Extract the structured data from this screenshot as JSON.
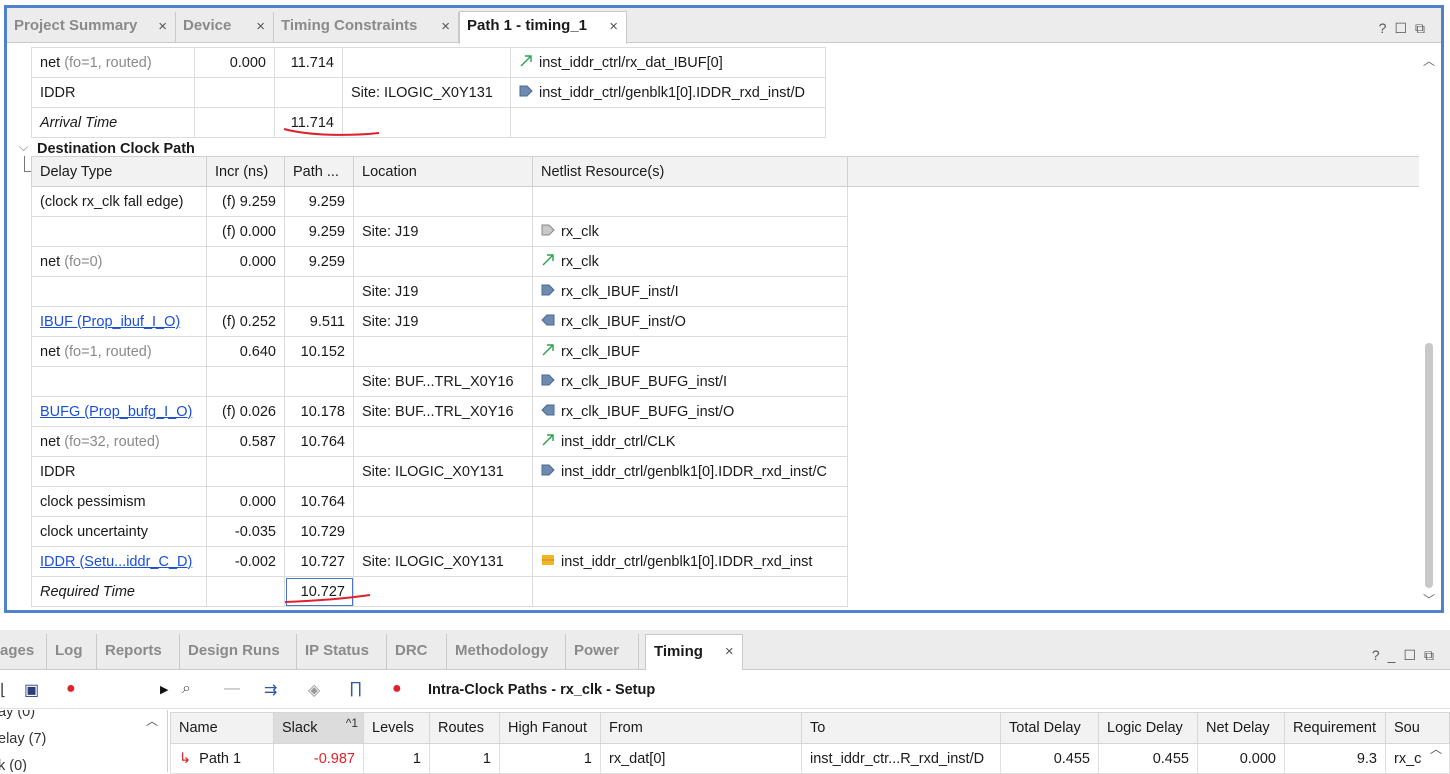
{
  "upper_tabs": [
    {
      "label": "Project Summary"
    },
    {
      "label": "Device"
    },
    {
      "label": "Timing Constraints"
    },
    {
      "label": "Path 1 - timing_1"
    }
  ],
  "top_rows": [
    {
      "type": "net",
      "detail": "(fo=1, routed)",
      "incr": "0.000",
      "path": "11.714",
      "location": "",
      "icon": "net-arrow-icon",
      "netlist": "inst_iddr_ctrl/rx_dat_IBUF[0]"
    },
    {
      "type": "IDDR",
      "detail": "",
      "incr": "",
      "path": "",
      "location": "Site: ILOGIC_X0Y131",
      "icon": "pin-in-icon",
      "netlist": "inst_iddr_ctrl/genblk1[0].IDDR_rxd_inst/D"
    }
  ],
  "arrival": {
    "label": "Arrival Time",
    "value": "11.714"
  },
  "destination": {
    "title": "Destination Clock Path",
    "columns": [
      "Delay Type",
      "Incr (ns)",
      "Path ...",
      "Location",
      "Netlist Resource(s)"
    ],
    "rows": [
      {
        "type": "(clock rx_clk fall edge)",
        "detail": "",
        "incr": "(f) 9.259",
        "path": "9.259",
        "location": "",
        "icon": "",
        "netlist": ""
      },
      {
        "type": "",
        "detail": "",
        "incr": "(f) 0.000",
        "path": "9.259",
        "location": "Site: J19",
        "icon": "port-icon",
        "netlist": "rx_clk"
      },
      {
        "type": "net",
        "detail": "(fo=0)",
        "incr": "0.000",
        "path": "9.259",
        "location": "",
        "icon": "net-arrow-icon",
        "netlist": "rx_clk"
      },
      {
        "type": "",
        "detail": "",
        "incr": "",
        "path": "",
        "location": "Site: J19",
        "icon": "pin-in-icon",
        "netlist": "rx_clk_IBUF_inst/I"
      },
      {
        "type": "IBUF (Prop_ibuf_I_O)",
        "link": true,
        "detail": "",
        "incr": "(f) 0.252",
        "path": "9.511",
        "location": "Site: J19",
        "icon": "pin-out-icon",
        "netlist": "rx_clk_IBUF_inst/O"
      },
      {
        "type": "net",
        "detail": "(fo=1, routed)",
        "incr": "0.640",
        "path": "10.152",
        "location": "",
        "icon": "net-arrow-icon",
        "netlist": "rx_clk_IBUF"
      },
      {
        "type": "",
        "detail": "",
        "incr": "",
        "path": "",
        "location": "Site: BUF...TRL_X0Y16",
        "icon": "pin-in-icon",
        "netlist": "rx_clk_IBUF_BUFG_inst/I"
      },
      {
        "type": "BUFG (Prop_bufg_I_O)",
        "link": true,
        "detail": "",
        "incr": "(f) 0.026",
        "path": "10.178",
        "location": "Site: BUF...TRL_X0Y16",
        "icon": "pin-out-icon",
        "netlist": "rx_clk_IBUF_BUFG_inst/O"
      },
      {
        "type": "net",
        "detail": "(fo=32, routed)",
        "incr": "0.587",
        "path": "10.764",
        "location": "",
        "icon": "net-arrow-icon",
        "netlist": "inst_iddr_ctrl/CLK"
      },
      {
        "type": "IDDR",
        "detail": "",
        "incr": "",
        "path": "",
        "location": "Site: ILOGIC_X0Y131",
        "icon": "pin-in-icon",
        "netlist": "inst_iddr_ctrl/genblk1[0].IDDR_rxd_inst/C"
      },
      {
        "type": "clock pessimism",
        "detail": "",
        "incr": "0.000",
        "path": "10.764",
        "location": "",
        "icon": "",
        "netlist": ""
      },
      {
        "type": "clock uncertainty",
        "detail": "",
        "incr": "-0.035",
        "path": "10.729",
        "location": "",
        "icon": "",
        "netlist": ""
      },
      {
        "type": "IDDR (Setu...iddr_C_D)",
        "link": true,
        "detail": "",
        "incr": "-0.002",
        "path": "10.727",
        "location": "Site: ILOGIC_X0Y131",
        "icon": "cell-icon",
        "netlist": "inst_iddr_ctrl/genblk1[0].IDDR_rxd_inst"
      }
    ],
    "required": {
      "label": "Required Time",
      "value": "10.727"
    }
  },
  "lower_tabs": [
    {
      "label": "ages"
    },
    {
      "label": "Log"
    },
    {
      "label": "Reports"
    },
    {
      "label": "Design Runs"
    },
    {
      "label": "IP Status"
    },
    {
      "label": "DRC"
    },
    {
      "label": "Methodology"
    },
    {
      "label": "Power"
    },
    {
      "label": "Timing"
    }
  ],
  "toolbar_title": "Intra-Clock Paths - rx_clk - Setup",
  "left_tree": [
    "ay (0)",
    "elay (7)",
    "k (0)"
  ],
  "paths_table": {
    "columns": [
      "Name",
      "Slack",
      "Levels",
      "Routes",
      "High Fanout",
      "From",
      "To",
      "Total Delay",
      "Logic Delay",
      "Net Delay",
      "Requirement",
      "Sou"
    ],
    "sort_indicator": "^1",
    "rows": [
      {
        "name": "Path 1",
        "slack": "-0.987",
        "levels": "1",
        "routes": "1",
        "fanout": "1",
        "from": "rx_dat[0]",
        "to": "inst_iddr_ctr...R_rxd_inst/D",
        "total": "0.455",
        "logic": "0.455",
        "net": "0.000",
        "req": "9.3",
        "src": "rx_c"
      }
    ]
  },
  "colors": {
    "accent_border": "#4f82c8",
    "link": "#1a4fd6",
    "negative": "#e0202a",
    "annotation": "#e0202a"
  }
}
